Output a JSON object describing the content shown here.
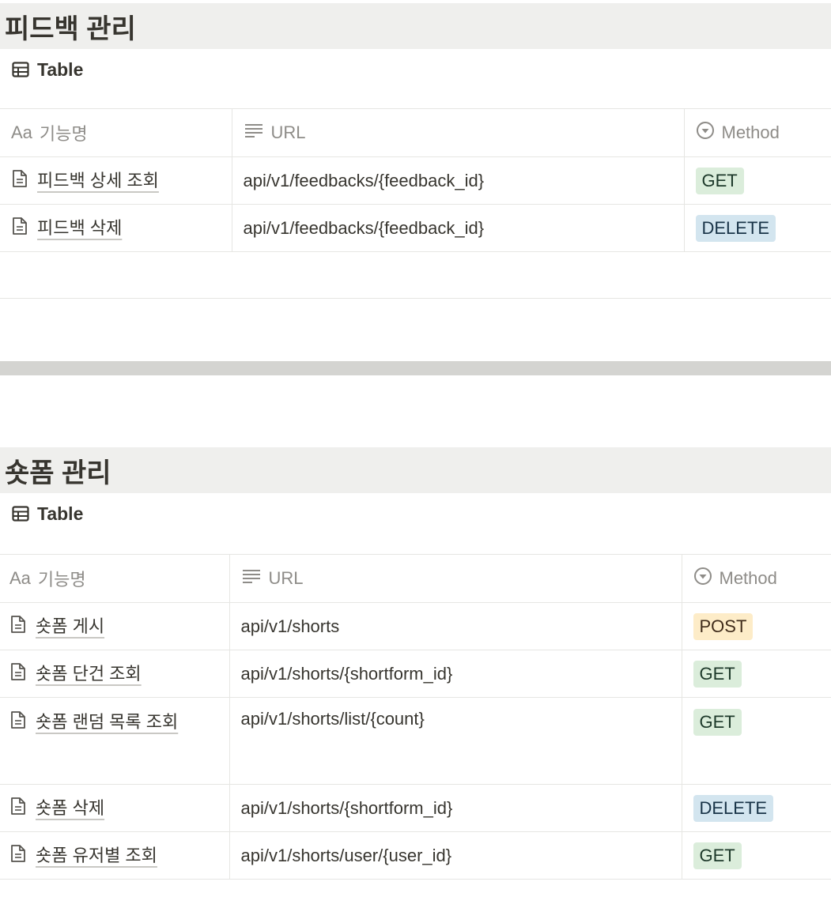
{
  "sections": [
    {
      "title": "피드백 관리",
      "view_label": "Table",
      "columns": {
        "name": "기능명",
        "url": "URL",
        "method": "Method",
        "name_prefix": "Aa"
      },
      "rows": [
        {
          "name": "피드백 상세 조회",
          "url": "api/v1/feedbacks/{feedback_id}",
          "method": "GET"
        },
        {
          "name": "피드백 삭제",
          "url": "api/v1/feedbacks/{feedback_id}",
          "method": "DELETE"
        }
      ]
    },
    {
      "title": "숏폼 관리",
      "view_label": "Table",
      "columns": {
        "name": "기능명",
        "url": "URL",
        "method": "Method",
        "name_prefix": "Aa"
      },
      "rows": [
        {
          "name": "숏폼 게시",
          "url": "api/v1/shorts",
          "method": "POST"
        },
        {
          "name": "숏폼 단건 조회",
          "url": "api/v1/shorts/{shortform_id}",
          "method": "GET"
        },
        {
          "name": "숏폼 랜덤 목록 조회",
          "url": "api/v1/shorts/list/{count}",
          "method": "GET"
        },
        {
          "name": "숏폼 삭제",
          "url": "api/v1/shorts/{shortform_id}",
          "method": "DELETE"
        },
        {
          "name": "숏폼 유저별 조회",
          "url": "api/v1/shorts/user/{user_id}",
          "method": "GET"
        }
      ]
    }
  ],
  "method_colors": {
    "GET": "#dbeddb",
    "DELETE": "#d3e5ef",
    "POST": "#fdecc8"
  },
  "icons": {
    "view": "table-icon",
    "row": "page-document-icon",
    "url_column": "text-lines-icon",
    "method_column": "select-circle-icon"
  }
}
